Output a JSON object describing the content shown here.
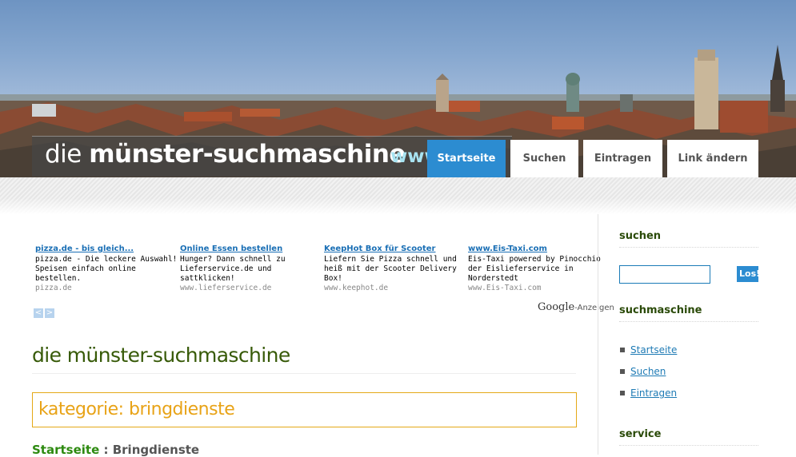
{
  "header": {
    "logo_light": "die ",
    "logo_bold": "münster-suchmaschine",
    "logo_url": "www.",
    "nav": [
      {
        "label": "Startseite",
        "active": true
      },
      {
        "label": "Suchen",
        "active": false
      },
      {
        "label": "Eintragen",
        "active": false
      },
      {
        "label": "Link ändern",
        "active": false
      }
    ]
  },
  "ads": [
    {
      "title": "pizza.de - bis gleich...",
      "text": "pizza.de - Die leckere Auswahl! Speisen einfach online bestellen.",
      "url": "pizza.de"
    },
    {
      "title": "Online Essen bestellen",
      "text": "Hunger? Dann schnell zu Lieferservice.de und sattklicken!",
      "url": "www.lieferservice.de"
    },
    {
      "title": "KeepHot Box für Scooter",
      "text": "Liefern Sie Pizza schnell und heiß mit der Scooter Delivery Box!",
      "url": "www.keephot.de"
    },
    {
      "title": "www.Eis-Taxi.com",
      "text": "Eis-Taxi powered by Pinocchio der Eislieferservice in Norderstedt",
      "url": "www.Eis-Taxi.com"
    }
  ],
  "ad_nav": {
    "prev": "<",
    "next": ">"
  },
  "google": {
    "brand": "Google",
    "suffix": "-Anzeigen"
  },
  "main": {
    "title": "die münster-suchmaschine",
    "category": "kategorie: bringdienste",
    "breadcrumb": {
      "home": "Startseite",
      "separator": " : ",
      "current": "Bringdienste"
    }
  },
  "sidebar": {
    "search_heading": "suchen",
    "search_value": "",
    "go_label": "Los!",
    "nav_heading": "suchmaschine",
    "nav_items": [
      "Startseite",
      "Suchen",
      "Eintragen"
    ],
    "service_heading": "service"
  },
  "colors": {
    "nav_active": "#2c8cd1",
    "title_green": "#375a08",
    "category_orange": "#e8a317",
    "link_blue": "#1f7bb5"
  }
}
